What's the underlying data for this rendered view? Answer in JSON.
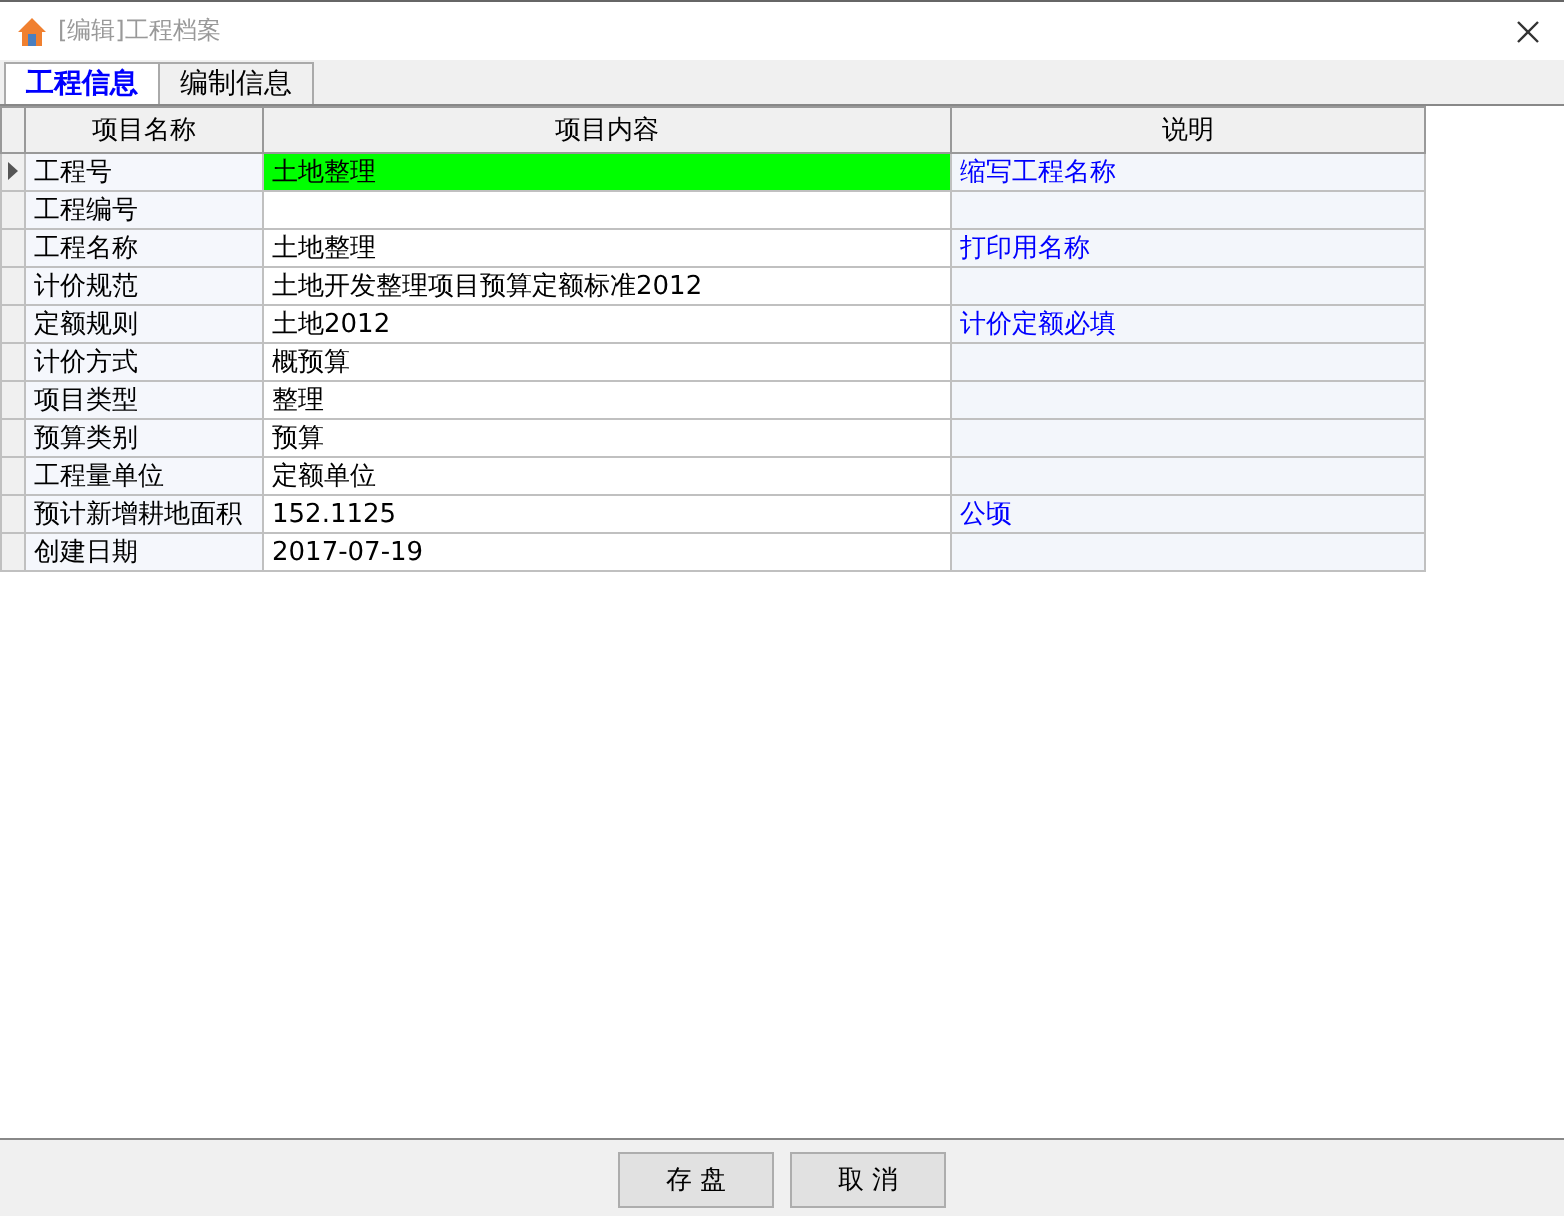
{
  "window": {
    "title": "[编辑]工程档案"
  },
  "tabs": [
    {
      "label": "工程信息",
      "selected": true
    },
    {
      "label": "编制信息",
      "selected": false
    }
  ],
  "table": {
    "columns": [
      "项目名称",
      "项目内容",
      "说明"
    ],
    "rows": [
      {
        "name": "工程号",
        "value": "土地整理",
        "note": "缩写工程名称",
        "selected": true
      },
      {
        "name": "工程编号",
        "value": "",
        "note": "",
        "selected": false
      },
      {
        "name": "工程名称",
        "value": "土地整理",
        "note": "打印用名称",
        "selected": false
      },
      {
        "name": "计价规范",
        "value": "土地开发整理项目预算定额标准2012",
        "note": "",
        "selected": false
      },
      {
        "name": "定额规则",
        "value": "土地2012",
        "note": "计价定额必填",
        "selected": false
      },
      {
        "name": "计价方式",
        "value": "概预算",
        "note": "",
        "selected": false
      },
      {
        "name": "项目类型",
        "value": "整理",
        "note": "",
        "selected": false
      },
      {
        "name": "预算类别",
        "value": "预算",
        "note": "",
        "selected": false
      },
      {
        "name": "工程量单位",
        "value": "定额单位",
        "note": "",
        "selected": false
      },
      {
        "name": "预计新增耕地面积",
        "value": "152.1125",
        "note": "公顷",
        "selected": false
      },
      {
        "name": "创建日期",
        "value": "2017-07-19",
        "note": "",
        "selected": false
      }
    ]
  },
  "buttons": [
    "存 盘",
    "取 消"
  ]
}
